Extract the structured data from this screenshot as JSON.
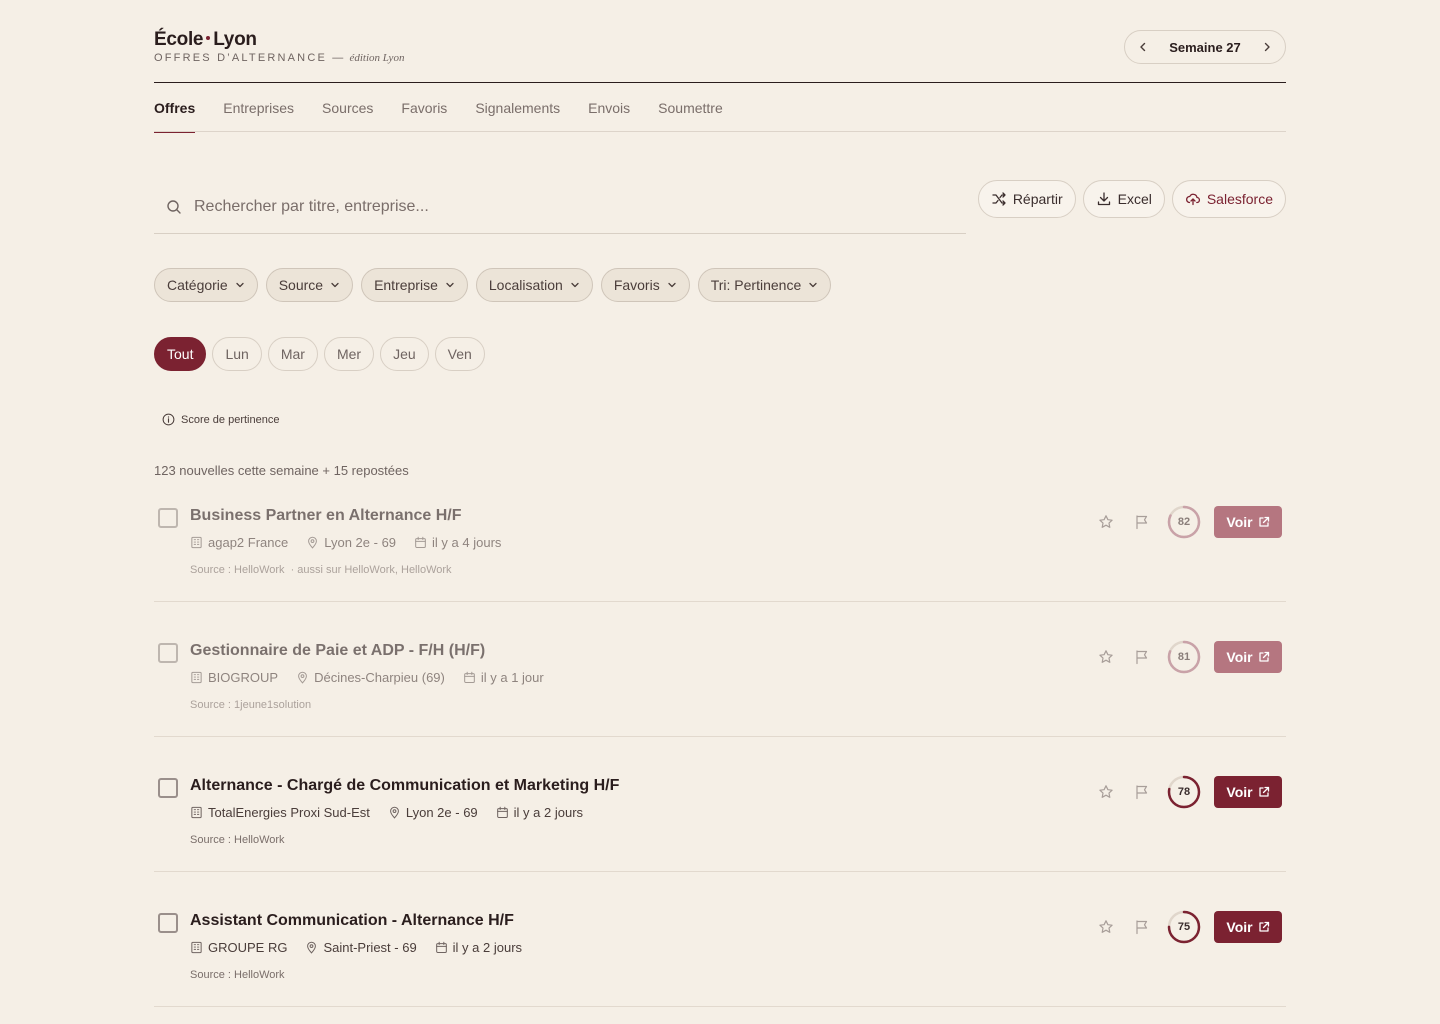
{
  "header": {
    "brand_left": "École",
    "brand_right": "Lyon",
    "subtitle": "OFFRES D’ALTERNANCE —",
    "edition": "édition Lyon",
    "week_label": "Semaine 27"
  },
  "tabs": [
    {
      "label": "Offres",
      "active": true
    },
    {
      "label": "Entreprises"
    },
    {
      "label": "Sources"
    },
    {
      "label": "Favoris"
    },
    {
      "label": "Signalements"
    },
    {
      "label": "Envois"
    },
    {
      "label": "Soumettre"
    }
  ],
  "search": {
    "placeholder": "Rechercher par titre, entreprise..."
  },
  "actions": {
    "repartir": "Répartir",
    "excel": "Excel",
    "salesforce": "Salesforce"
  },
  "filters": [
    "Catégorie",
    "Source",
    "Entreprise",
    "Localisation",
    "Favoris",
    "Tri: Pertinence"
  ],
  "days": [
    "Tout",
    "Lun",
    "Mar",
    "Mer",
    "Jeu",
    "Ven"
  ],
  "score_legend": "Score de pertinence",
  "count_text": "123 nouvelles cette semaine + 15 repostées",
  "voir_label": "Voir",
  "jobs": [
    {
      "title": "Business Partner en Alternance H/F",
      "company": "agap2 France",
      "location": "Lyon 2e - 69",
      "date": "il y a 4 jours",
      "source": "Source : HelloWork",
      "also": "· aussi sur HelloWork, HelloWork",
      "score": 82,
      "seen": true
    },
    {
      "title": "Gestionnaire de Paie et ADP - F/H (H/F)",
      "company": "BIOGROUP",
      "location": "Décines-Charpieu (69)",
      "date": "il y a 1 jour",
      "source": "Source : 1jeune1solution",
      "also": "",
      "score": 81,
      "seen": true
    },
    {
      "title": "Alternance - Chargé de Communication et Marketing H/F",
      "company": "TotalEnergies Proxi Sud-Est",
      "location": "Lyon 2e - 69",
      "date": "il y a 2 jours",
      "source": "Source : HelloWork",
      "also": "",
      "score": 78,
      "seen": false
    },
    {
      "title": "Assistant Communication - Alternance H/F",
      "company": "GROUPE RG",
      "location": "Saint-Priest - 69",
      "date": "il y a 2 jours",
      "source": "Source : HelloWork",
      "also": "",
      "score": 75,
      "seen": false
    }
  ],
  "colors": {
    "accent": "#7b2231",
    "background": "#f5efe6",
    "muted": "#7a6e6a"
  },
  "icons": {
    "search": "search-icon",
    "shuffle": "shuffle-icon",
    "download": "download-icon",
    "cloud": "cloud-upload-icon",
    "chevron": "chevron-down-icon",
    "info": "info-icon",
    "building": "building-icon",
    "pin": "map-pin-icon",
    "calendar": "calendar-icon",
    "star": "star-icon",
    "flag": "flag-icon",
    "external": "external-link-icon"
  }
}
